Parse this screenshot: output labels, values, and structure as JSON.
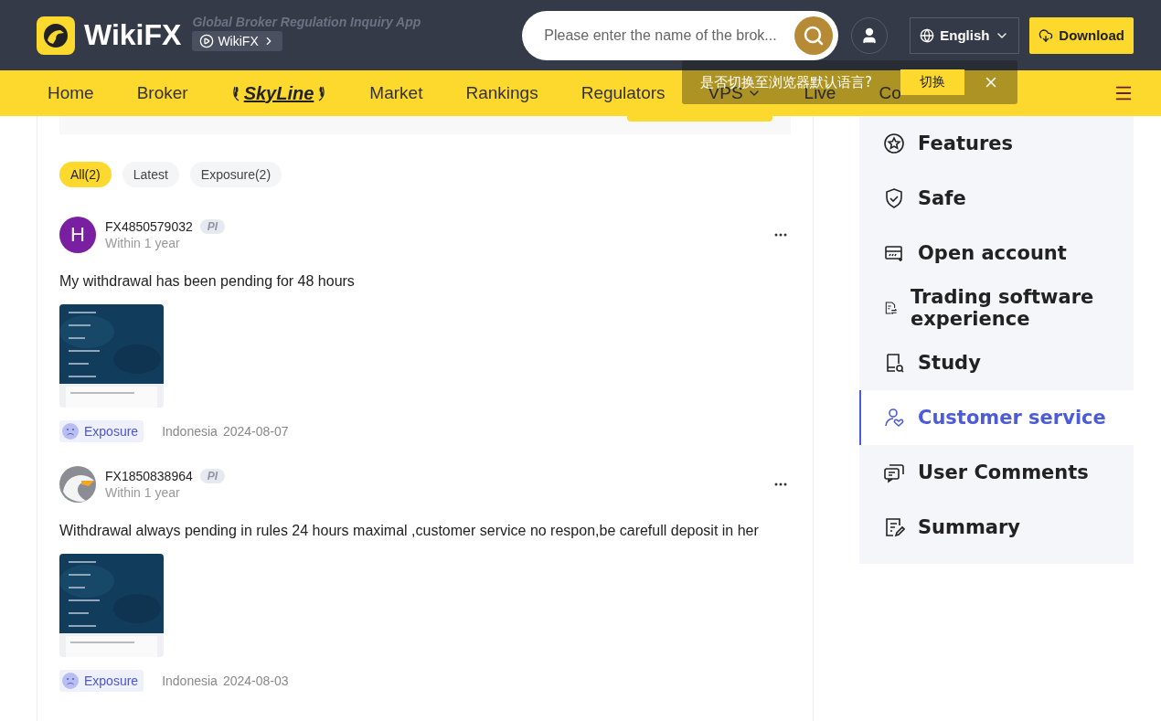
{
  "header": {
    "logo": "WikiFX",
    "tagline": "Global Broker Regulation Inquiry App",
    "app_link": "WikiFX",
    "search": {
      "placeholder": "Please enter the name of the brok..."
    },
    "language": "English",
    "download": "Download"
  },
  "nav": {
    "items": [
      {
        "label": "Home",
        "kind": "text"
      },
      {
        "label": "Broker",
        "kind": "text"
      },
      {
        "label": "SkyLine",
        "kind": "logo"
      },
      {
        "label": "Market",
        "kind": "text"
      },
      {
        "label": "Rankings",
        "kind": "text"
      },
      {
        "label": "Regulators",
        "kind": "text"
      },
      {
        "label": "VPS",
        "kind": "dropdown"
      },
      {
        "label": "Live",
        "kind": "text"
      },
      {
        "label": "Co",
        "kind": "text"
      }
    ]
  },
  "toast": {
    "message": "是否切换至浏览器默认语言?",
    "button": "切换"
  },
  "filters": [
    {
      "label": "All(2)",
      "selected": true
    },
    {
      "label": "Latest",
      "selected": false
    },
    {
      "label": "Exposure(2)",
      "selected": false
    }
  ],
  "posts": [
    {
      "avatar": {
        "kind": "letter",
        "letter": "H",
        "color": "#7b1fa2"
      },
      "user": "FX4850579032",
      "badge": "PI",
      "time": "Within 1 year",
      "text": "My withdrawal has been pending for 48 hours",
      "tag": "Exposure",
      "country": "Indonesia",
      "date": "2024-08-07"
    },
    {
      "avatar": {
        "kind": "eagle"
      },
      "user": "FX1850838964",
      "badge": "PI",
      "time": "Within 1 year",
      "text": "Withdrawal always pending in rules 24 hours maximal ,customer service no respon,be carefull deposit in her",
      "tag": "Exposure",
      "country": "Indonesia",
      "date": "2024-08-03"
    }
  ],
  "sidebar": {
    "items": [
      {
        "label": "Features",
        "kind": "star",
        "selected": false
      },
      {
        "label": "Safe",
        "kind": "shield",
        "selected": false
      },
      {
        "label": "Open account",
        "kind": "card",
        "selected": false
      },
      {
        "label": "Trading software experience",
        "kind": "doc",
        "selected": false
      },
      {
        "label": "Study",
        "kind": "study",
        "selected": false
      },
      {
        "label": "Customer service",
        "kind": "service",
        "selected": true
      },
      {
        "label": "User Comments",
        "kind": "comments",
        "selected": false
      },
      {
        "label": "Summary",
        "kind": "summary",
        "selected": false
      }
    ]
  }
}
